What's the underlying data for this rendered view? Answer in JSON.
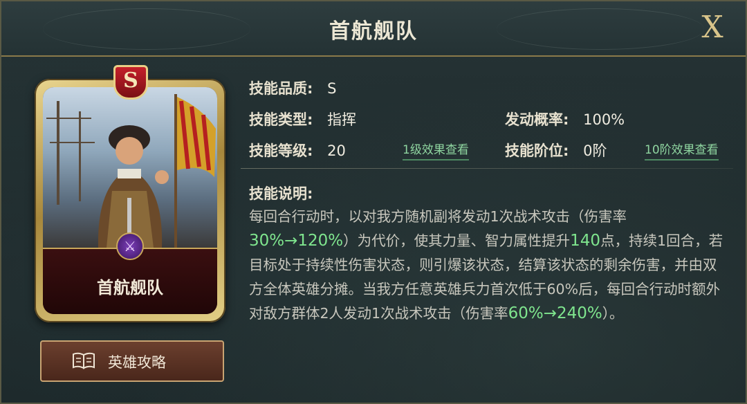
{
  "header": {
    "title": "首航舰队",
    "close_label": "X"
  },
  "card": {
    "name": "首航舰队",
    "grade": "S",
    "type_emblem": "⚔"
  },
  "guide_button": {
    "label": "英雄攻略"
  },
  "skill": {
    "quality_label": "技能品质:",
    "quality_value": "S",
    "type_label": "技能类型:",
    "type_value": "指挥",
    "rate_label": "发动概率:",
    "rate_value": "100%",
    "level_label": "技能等级:",
    "level_value": "20",
    "level1_link": "1级效果查看",
    "tier_label": "技能阶位:",
    "tier_value": "0阶",
    "tier10_link": "10阶效果查看",
    "desc_label": "技能说明:",
    "desc": {
      "p1": "每回合行动时，以对我方随机副将发动1次战术攻击（伤害率",
      "h1": "30%→120%",
      "p2": "）为代价，使其力量、智力属性提升",
      "h2": "140",
      "p3": "点，持续1回合，若目标处于持续性伤害状态，则引爆该状态，结算该状态的剩余伤害，并由双方全体英雄分摊。当我方任意英雄兵力首次低于60%后，每回合行动时额外对敌方群体2人发动1次战术攻击（伤害率",
      "h3": "60%→240%",
      "p4": "）。"
    }
  },
  "colors": {
    "highlight": "#7fe58e",
    "gold": "#c9a85a",
    "panel": "#1e2a2c"
  }
}
